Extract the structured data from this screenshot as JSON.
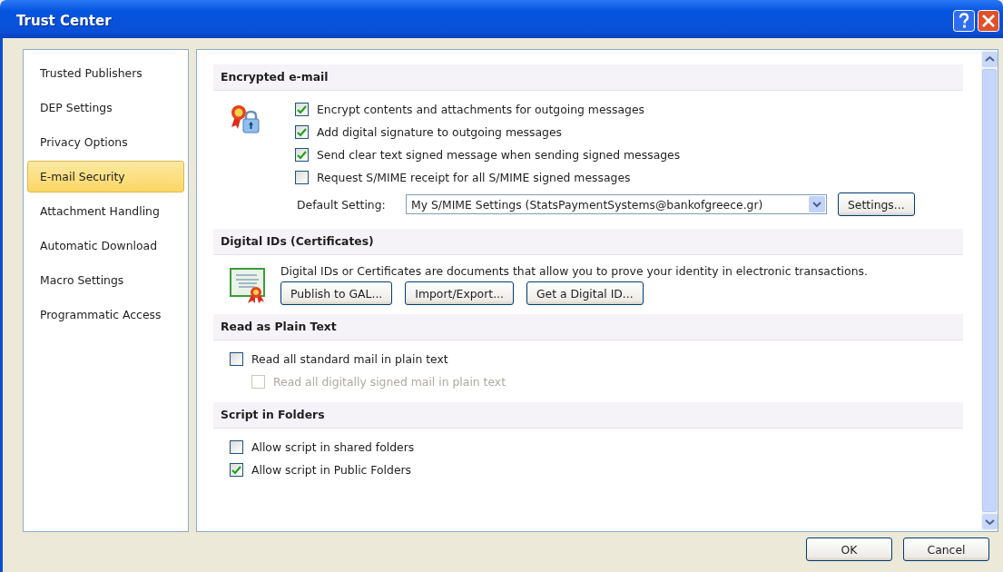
{
  "window": {
    "title": "Trust Center"
  },
  "sidebar": {
    "items": [
      {
        "label": "Trusted Publishers",
        "selected": false
      },
      {
        "label": "DEP Settings",
        "selected": false
      },
      {
        "label": "Privacy Options",
        "selected": false
      },
      {
        "label": "E-mail Security",
        "selected": true
      },
      {
        "label": "Attachment Handling",
        "selected": false
      },
      {
        "label": "Automatic Download",
        "selected": false
      },
      {
        "label": "Macro Settings",
        "selected": false
      },
      {
        "label": "Programmatic Access",
        "selected": false
      }
    ]
  },
  "sections": [
    {
      "title": "Encrypted e-mail",
      "rows": [
        {
          "kind": "checkbox",
          "label": "Encrypt contents and attachments for outgoing messages",
          "checked": true,
          "disabled": false
        },
        {
          "kind": "checkbox",
          "label": "Add digital signature to outgoing messages",
          "checked": true,
          "disabled": false
        },
        {
          "kind": "checkbox",
          "label": "Send clear text signed message when sending signed messages",
          "checked": true,
          "disabled": false
        },
        {
          "kind": "checkbox",
          "label": "Request S/MIME receipt for all S/MIME signed messages",
          "checked": false,
          "disabled": false
        },
        {
          "kind": "select",
          "label": "Default Setting:",
          "value": "My S/MIME Settings (StatsPaymentSystems@bankofgreece.gr)",
          "button": "Settings..."
        }
      ]
    },
    {
      "title": "Digital IDs (Certificates)",
      "rows": [
        {
          "kind": "text",
          "text": "Digital IDs or Certificates are documents that allow you to prove your identity in electronic transactions."
        },
        {
          "kind": "buttons",
          "buttons": [
            "Publish to GAL...",
            "Import/Export...",
            "Get a Digital ID..."
          ]
        }
      ]
    },
    {
      "title": "Read as Plain Text",
      "rows": [
        {
          "kind": "checkbox",
          "label": "Read all standard mail in plain text",
          "checked": false,
          "disabled": false,
          "children": [
            {
              "label": "Read all digitally signed mail in plain text",
              "checked": false,
              "disabled": true
            }
          ]
        }
      ]
    },
    {
      "title": "Script in Folders",
      "rows": [
        {
          "kind": "checkbox",
          "label": "Allow script in shared folders",
          "checked": false,
          "disabled": false
        },
        {
          "kind": "checkbox",
          "label": "Allow script in Public Folders",
          "checked": true,
          "disabled": false
        }
      ]
    }
  ],
  "buttons": [
    "OK",
    "Cancel"
  ]
}
